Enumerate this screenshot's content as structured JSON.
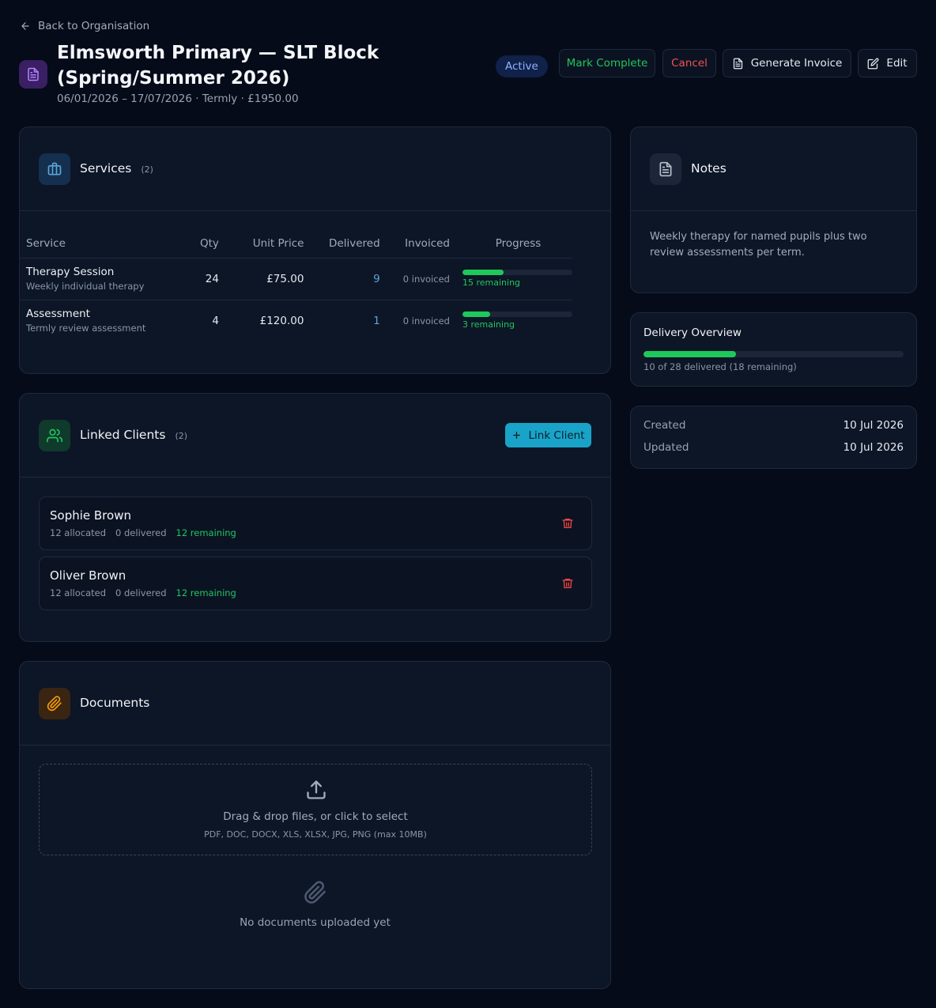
{
  "nav": {
    "back_label": "Back to Organisation"
  },
  "header": {
    "title": "Elmsworth Primary — SLT Block (Spring/Summer 2026)",
    "subtitle": "06/01/2026 – 17/07/2026 · Termly · £1950.00",
    "status": "Active",
    "actions": {
      "mark_complete": "Mark Complete",
      "cancel": "Cancel",
      "generate_invoice": "Generate Invoice",
      "edit": "Edit"
    }
  },
  "services": {
    "title": "Services",
    "count": "(2)",
    "columns": [
      "Service",
      "Qty",
      "Unit Price",
      "Delivered",
      "Invoiced",
      "Progress"
    ],
    "rows": [
      {
        "name": "Therapy Session",
        "desc": "Weekly individual therapy",
        "qty": "24",
        "unit_price": "£75.00",
        "delivered": "9",
        "invoiced": "0 invoiced",
        "remaining": "15 remaining",
        "progress": 0.375
      },
      {
        "name": "Assessment",
        "desc": "Termly review assessment",
        "qty": "4",
        "unit_price": "£120.00",
        "delivered": "1",
        "invoiced": "0 invoiced",
        "remaining": "3 remaining",
        "progress": 0.25
      }
    ]
  },
  "clients": {
    "title": "Linked Clients",
    "count": "(2)",
    "link_label": "Link Client",
    "items": [
      {
        "name": "Sophie Brown",
        "allocated": "12 allocated",
        "delivered": "0 delivered",
        "remaining": "12 remaining"
      },
      {
        "name": "Oliver Brown",
        "allocated": "12 allocated",
        "delivered": "0 delivered",
        "remaining": "12 remaining"
      }
    ]
  },
  "documents": {
    "title": "Documents",
    "drop_text": "Drag & drop files, or click to select",
    "drop_hint": "PDF, DOC, DOCX, XLS, XLSX, JPG, PNG (max 10MB)",
    "empty_text": "No documents uploaded yet"
  },
  "notes": {
    "title": "Notes",
    "text": "Weekly therapy for named pupils plus two review assessments per term."
  },
  "delivery": {
    "title": "Delivery Overview",
    "summary": "10 of 28 delivered (18 remaining)",
    "progress": 0.357
  },
  "meta": {
    "created_label": "Created",
    "created_value": "10 Jul 2026",
    "updated_label": "Updated",
    "updated_value": "10 Jul 2026"
  },
  "colors": {
    "background": "#050b19",
    "card": "#0d1626",
    "progress_green": "#1ec85a",
    "accent_cyan": "#1aa3c8",
    "danger": "#ef4444"
  }
}
